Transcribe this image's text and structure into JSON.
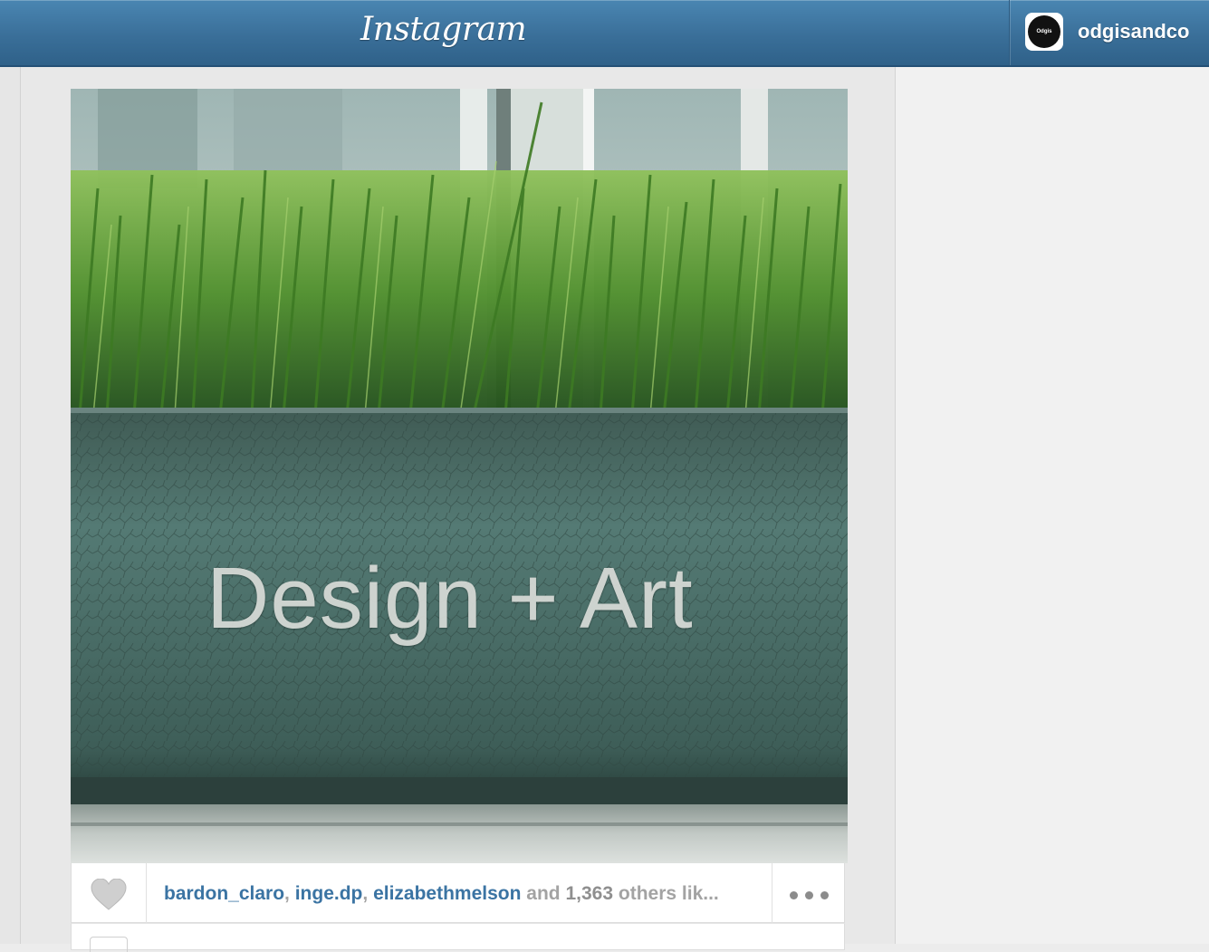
{
  "header": {
    "logo_text": "Instagram",
    "username": "odgisandco",
    "avatar_text": "Odgis"
  },
  "post": {
    "image_text": "Design + Art",
    "likes": {
      "users": [
        "bardon_claro",
        "inge.dp",
        "elizabethmelson"
      ],
      "separator": ", ",
      "conjunction": "and",
      "count": "1,363",
      "suffix": "others lik..."
    },
    "more_icon": "ellipsis-icon",
    "like_icon": "heart-icon"
  },
  "colors": {
    "header_blue": "#3a6f99",
    "link_blue": "#3b74a3",
    "background": "#e8e8e8"
  }
}
